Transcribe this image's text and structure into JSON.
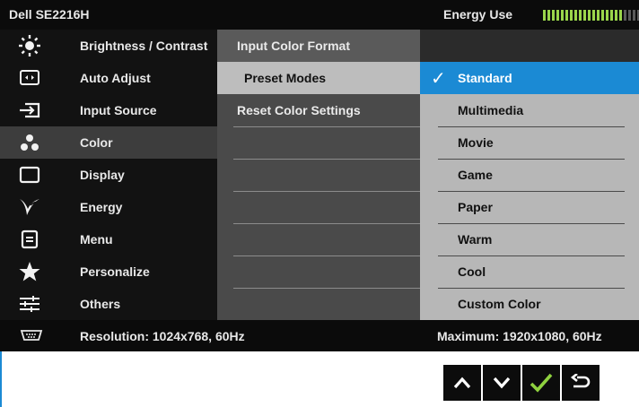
{
  "header": {
    "model": "Dell SE2216H",
    "energy_label": "Energy Use",
    "energy_level": 0.7
  },
  "menu": {
    "items": [
      {
        "label": "Brightness / Contrast",
        "icon": "brightness-icon"
      },
      {
        "label": "Auto Adjust",
        "icon": "auto-adjust-icon"
      },
      {
        "label": "Input Source",
        "icon": "input-source-icon"
      },
      {
        "label": "Color",
        "icon": "color-icon",
        "selected": true
      },
      {
        "label": "Display",
        "icon": "display-icon"
      },
      {
        "label": "Energy",
        "icon": "energy-icon"
      },
      {
        "label": "Menu",
        "icon": "menu-icon"
      },
      {
        "label": "Personalize",
        "icon": "personalize-star-icon"
      },
      {
        "label": "Others",
        "icon": "others-sliders-icon"
      }
    ]
  },
  "submenu": {
    "title": "Input Color Format",
    "items": [
      "Preset Modes",
      "Reset Color Settings"
    ],
    "highlighted": "Preset Modes"
  },
  "preset_modes": {
    "options": [
      "Standard",
      "Multimedia",
      "Movie",
      "Game",
      "Paper",
      "Warm",
      "Cool",
      "Custom Color"
    ],
    "selected": "Standard"
  },
  "status": {
    "resolution": "Resolution: 1024x768, 60Hz",
    "maximum": "Maximum: 1920x1080, 60Hz"
  },
  "colors": {
    "accent": "#1b8ad4",
    "meter_on": "#9bd64b",
    "meter_off": "#5a5a5a"
  },
  "buttons": [
    "up-arrow-icon",
    "down-arrow-icon",
    "check-icon",
    "back-icon"
  ]
}
